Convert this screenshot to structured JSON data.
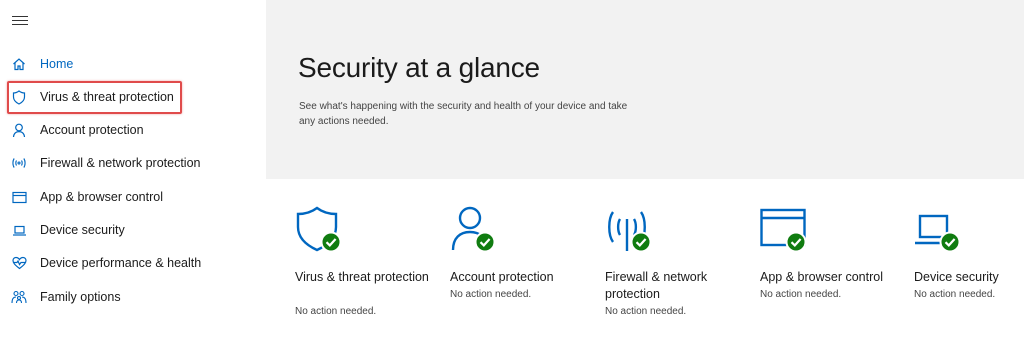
{
  "sidebar": {
    "items": [
      {
        "label": "Home",
        "icon": "home-icon"
      },
      {
        "label": "Virus & threat protection",
        "icon": "shield-icon"
      },
      {
        "label": "Account protection",
        "icon": "person-icon"
      },
      {
        "label": "Firewall & network protection",
        "icon": "antenna-icon"
      },
      {
        "label": "App & browser control",
        "icon": "browser-window-icon"
      },
      {
        "label": "Device security",
        "icon": "laptop-icon"
      },
      {
        "label": "Device performance & health",
        "icon": "heart-icon"
      },
      {
        "label": "Family options",
        "icon": "family-icon"
      }
    ]
  },
  "hero": {
    "title": "Security at a glance",
    "subtitle": "See what's happening with the security and health of your device and take any actions needed."
  },
  "tiles": [
    {
      "name": "Virus & threat protection",
      "status": "No action needed.",
      "icon": "shield-check-icon"
    },
    {
      "name": "Account protection",
      "status": "No action needed.",
      "icon": "person-check-icon"
    },
    {
      "name": "Firewall & network protection",
      "status": "No action needed.",
      "icon": "antenna-check-icon"
    },
    {
      "name": "App & browser control",
      "status": "No action needed.",
      "icon": "browser-check-icon"
    },
    {
      "name": "Device security",
      "status": "No action needed.",
      "icon": "laptop-check-icon"
    }
  ],
  "colors": {
    "accent": "#0067c0",
    "success": "#107c10",
    "highlight": "#e04b4b",
    "hero_bg": "#f2f2f2"
  }
}
